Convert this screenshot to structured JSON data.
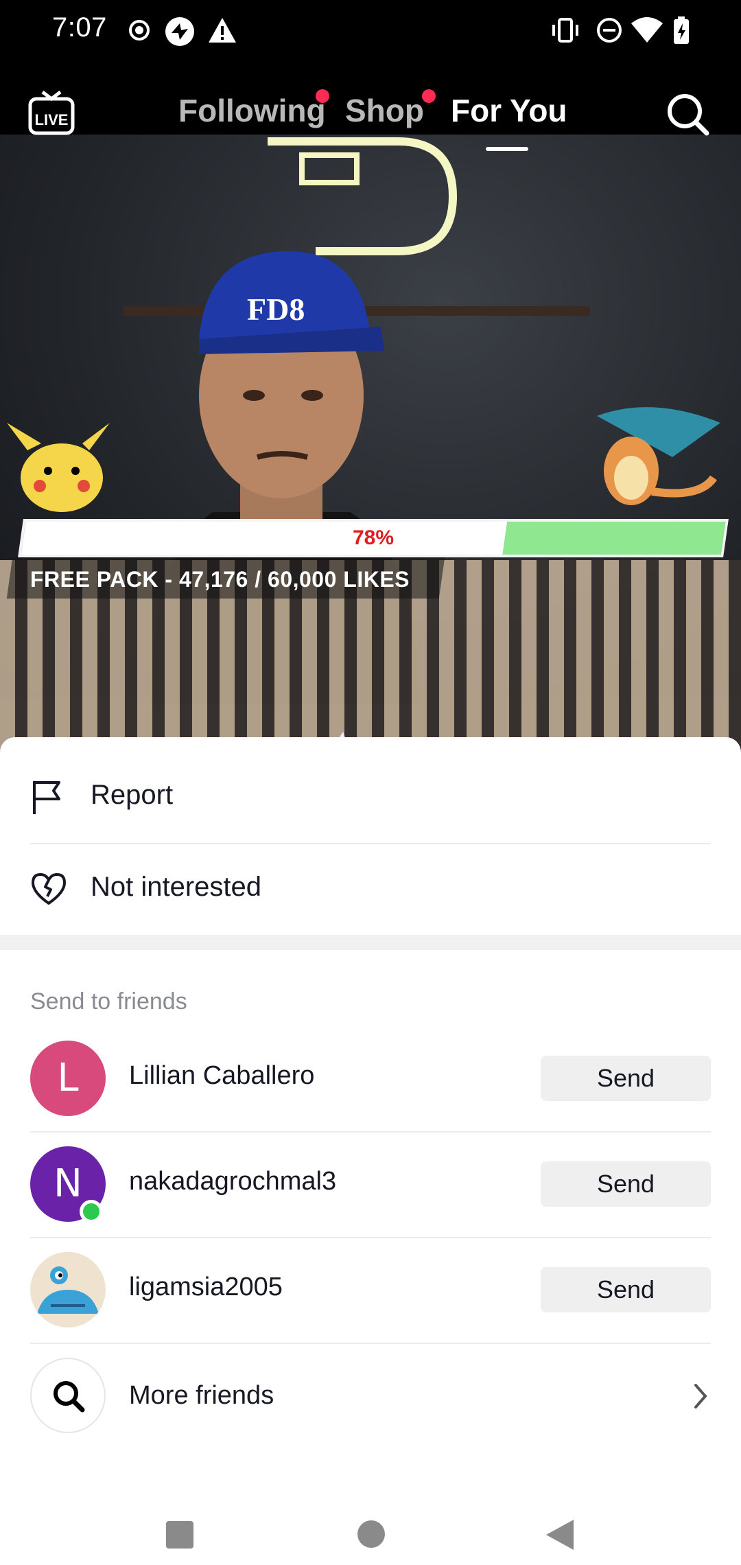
{
  "status_bar": {
    "time": "7:07"
  },
  "top_nav": {
    "tabs": [
      {
        "label": "Following",
        "has_dot": true
      },
      {
        "label": "Shop",
        "has_dot": true
      },
      {
        "label": "For You",
        "active": true
      }
    ]
  },
  "video": {
    "progress_label": "78%",
    "progress_percent": 78,
    "overlay_text": "FREE PACK - 47,176 / 60,000 LIKES"
  },
  "sheet": {
    "menu": [
      {
        "label": "Report",
        "icon": "flag-icon"
      },
      {
        "label": "Not interested",
        "icon": "broken-heart-icon"
      }
    ],
    "send_section_title": "Send to friends",
    "friends": [
      {
        "initial": "L",
        "name": "Lillian Caballero",
        "avatar_color": "#d94a7c",
        "online": false,
        "action": "Send"
      },
      {
        "initial": "N",
        "name": "nakadagrochmal3",
        "avatar_color": "#6a22a8",
        "online": true,
        "action": "Send"
      },
      {
        "initial": "",
        "name": "ligamsia2005",
        "avatar_color": "#efe3cf",
        "online": false,
        "action": "Send"
      }
    ],
    "more_friends": "More friends"
  },
  "colors": {
    "accent": "#fe2c55",
    "online": "#2dc84d",
    "progress_green": "#8fe88f"
  }
}
